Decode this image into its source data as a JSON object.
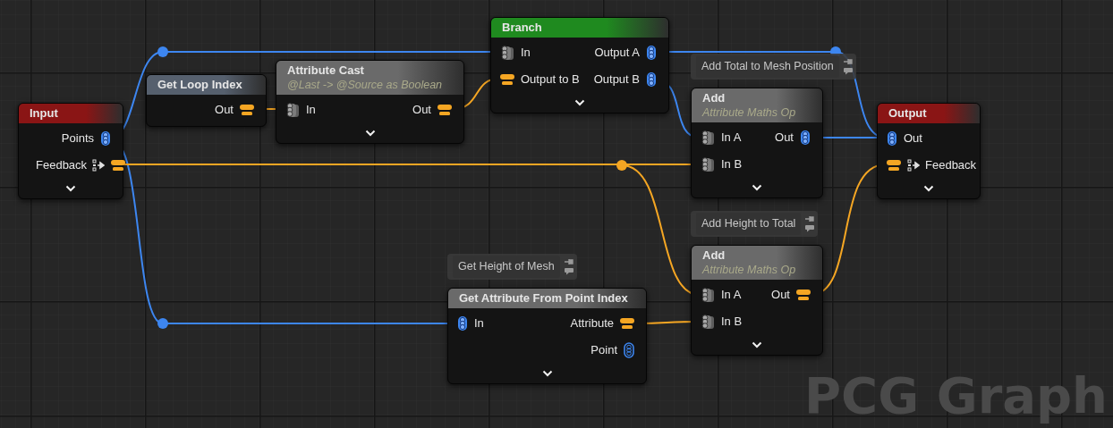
{
  "graph": {
    "nodes": [
      {
        "title": "Input",
        "color": "#8a1515",
        "expander": true,
        "rows": [
          {
            "right": {
              "label": "Points",
              "kind": "points"
            }
          },
          {
            "right": {
              "label": "Feedback",
              "kind": "feedback"
            }
          }
        ]
      },
      {
        "title": "Get Loop Index",
        "color": "#56606e",
        "expander": false,
        "rows": [
          {
            "right": {
              "label": "Out",
              "kind": "attribute"
            }
          }
        ]
      },
      {
        "title": "Attribute Cast",
        "subtitle": "@Last -> @Source as Boolean",
        "color": "#6a6a6a",
        "expander": true,
        "rows": [
          {
            "left": {
              "label": "In",
              "kind": "any"
            },
            "right": {
              "label": "Out",
              "kind": "attribute"
            }
          }
        ]
      },
      {
        "title": "Branch",
        "color": "#1f8a1f",
        "expander": true,
        "rows": [
          {
            "left": {
              "label": "In",
              "kind": "any"
            },
            "right": {
              "label": "Output A",
              "kind": "points"
            }
          },
          {
            "left": {
              "label": "Output to B",
              "kind": "attribute"
            },
            "right": {
              "label": "Output B",
              "kind": "points"
            }
          }
        ]
      },
      {
        "title": "Add",
        "subtitle": "Attribute Maths Op",
        "comment": "Add Total to Mesh Position",
        "color": "#6a6a6a",
        "expander": true,
        "rows": [
          {
            "left": {
              "label": "In A",
              "kind": "any"
            },
            "right": {
              "label": "Out",
              "kind": "points"
            }
          },
          {
            "left": {
              "label": "In B",
              "kind": "any"
            }
          }
        ]
      },
      {
        "title": "Output",
        "color": "#8a1515",
        "expander": true,
        "rows": [
          {
            "left": {
              "label": "Out",
              "kind": "points"
            }
          },
          {
            "left": {
              "label": "Feedback",
              "kind": "feedback"
            }
          }
        ]
      },
      {
        "title": "Add",
        "subtitle": "Attribute Maths Op",
        "comment": "Add Height to Total",
        "color": "#6a6a6a",
        "expander": true,
        "rows": [
          {
            "left": {
              "label": "In A",
              "kind": "any"
            },
            "right": {
              "label": "Out",
              "kind": "attribute"
            }
          },
          {
            "left": {
              "label": "In B",
              "kind": "any"
            }
          }
        ]
      },
      {
        "title": "Get Attribute From Point Index",
        "comment": "Get Height of Mesh",
        "color": "#6a6a6a",
        "expander": true,
        "rows": [
          {
            "left": {
              "label": "In",
              "kind": "points"
            },
            "right": {
              "label": "Attribute",
              "kind": "attribute"
            }
          },
          {
            "right": {
              "label": "Point",
              "kind": "point"
            }
          }
        ]
      }
    ],
    "graph_type": "PCG Graph"
  }
}
